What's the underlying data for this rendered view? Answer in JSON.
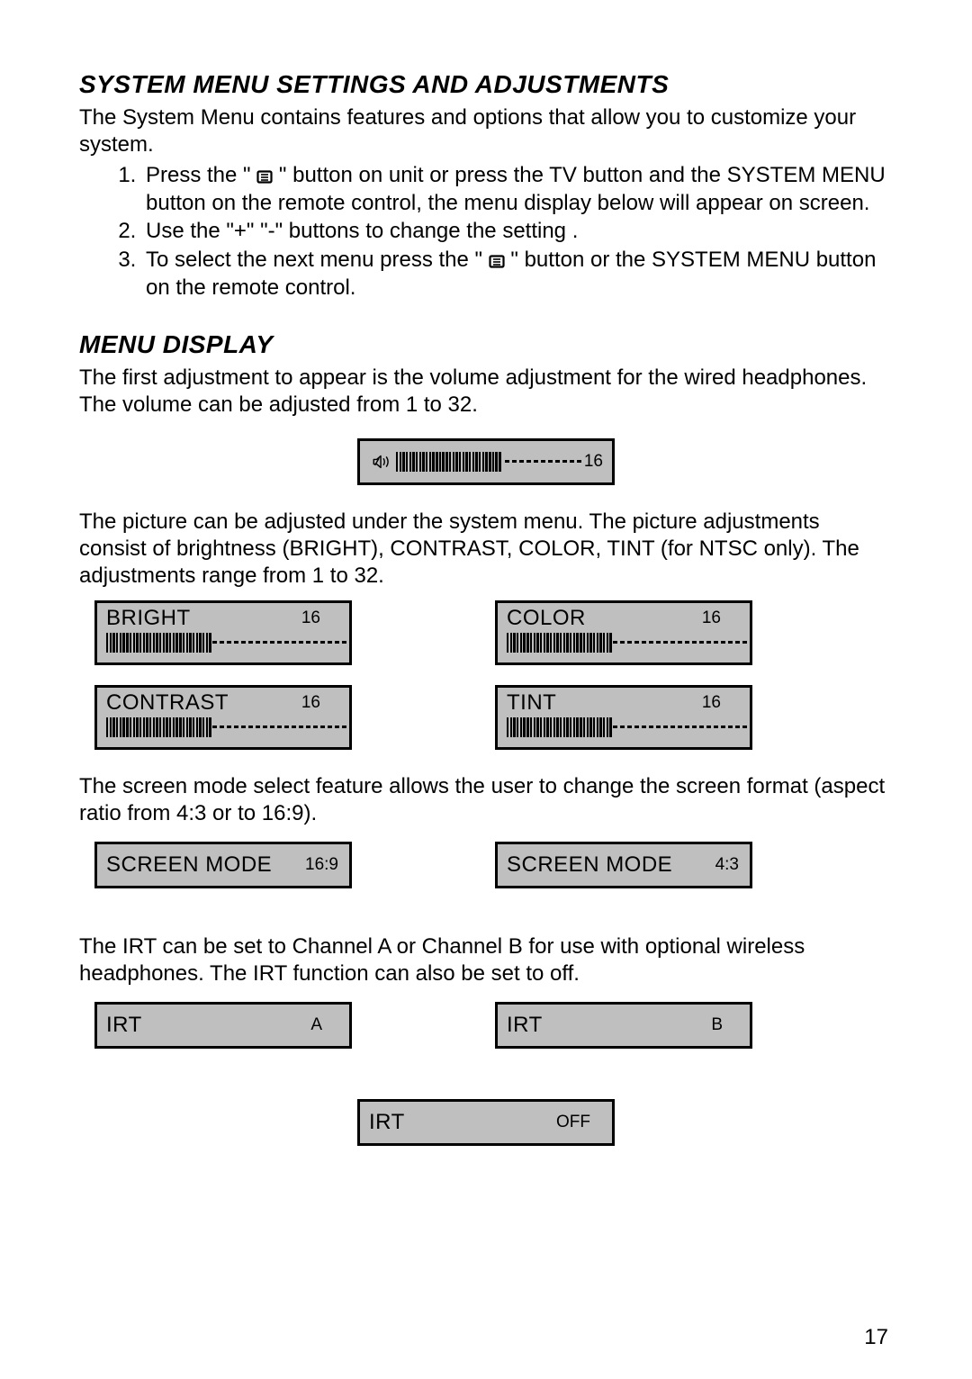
{
  "headings": {
    "main": "SYSTEM MENU SETTINGS AND ADJUSTMENTS",
    "menu_display": "MENU DISPLAY"
  },
  "intro": "The System Menu contains features and options that allow you to customize your system.",
  "steps": {
    "s1a": "Press the \" ",
    "s1b": " \" button on unit or press the TV button and the SYSTEM MENU button on the remote control, the menu display below will appear on screen.",
    "s2": "Use the \"+\" \"-\" buttons  to change the setting .",
    "s3a": "To select the next menu press  the \" ",
    "s3b": " \" button or the SYSTEM MENU button on the remote control."
  },
  "menu_display_intro": "The first adjustment to appear is the volume adjustment for the wired headphones. The volume can be adjusted from 1 to 32.",
  "volume": {
    "value": "16"
  },
  "picture_intro": "The picture can be adjusted under the system menu. The picture adjustments consist of brightness (BRIGHT), CONTRAST, COLOR, TINT (for NTSC only). The adjustments range from 1 to 32.",
  "picture": {
    "bright": {
      "label": "BRIGHT",
      "value": "16"
    },
    "color": {
      "label": "COLOR",
      "value": "16"
    },
    "contrast": {
      "label": "CONTRAST",
      "value": "16"
    },
    "tint": {
      "label": "TINT",
      "value": "16"
    }
  },
  "screen_mode_intro": "The screen mode select feature allows the user to change the screen format (aspect ratio from 4:3 or to 16:9).",
  "screen_mode": {
    "label": "SCREEN MODE",
    "v169": "16:9",
    "v43": "4:3"
  },
  "irt_intro": "The IRT can be set to Channel A or Channel B for use with optional wireless headphones. The IRT function can also be set to off.",
  "irt": {
    "label": "IRT",
    "a": "A",
    "b": "B",
    "off": "OFF"
  },
  "page_number": "17"
}
